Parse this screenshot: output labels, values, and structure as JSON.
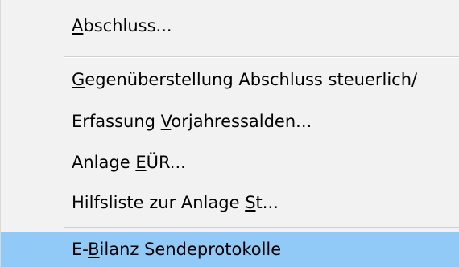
{
  "menu": {
    "items": [
      {
        "pre": "",
        "accel": "A",
        "post": "bschluss...",
        "highlighted": false
      },
      {
        "pre": "",
        "accel": "G",
        "post": "egenüberstellung Abschluss steuerlich/",
        "highlighted": false
      },
      {
        "pre": "Erfassung ",
        "accel": "V",
        "post": "orjahressalden...",
        "highlighted": false
      },
      {
        "pre": "Anlage ",
        "accel": "E",
        "post": "ÜR...",
        "highlighted": false
      },
      {
        "pre": "Hilfsliste zur Anlage ",
        "accel": "S",
        "post": "t...",
        "highlighted": false
      },
      {
        "pre": "E-",
        "accel": "B",
        "post": "ilanz Sendeprotokolle",
        "highlighted": true
      }
    ]
  },
  "colors": {
    "menu_background": "#f2f2f2",
    "highlight": "#91c9f7",
    "separator": "#d0d0d0",
    "text": "#000000"
  }
}
